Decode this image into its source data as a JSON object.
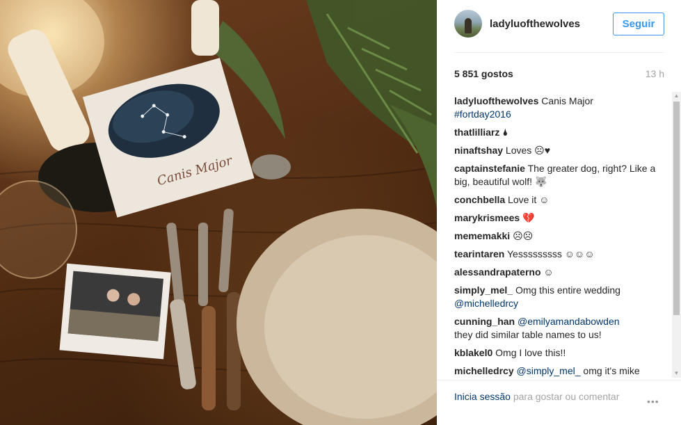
{
  "post": {
    "username": "ladyluofthewolves",
    "follow_label": "Seguir",
    "likes": "5 851 gostos",
    "time_ago": "13 h"
  },
  "comments": [
    {
      "user": "ladyluofthewolves",
      "text": "Canis Major",
      "link": "#fortday2016"
    },
    {
      "user": "thatlilliarz",
      "text": "🌢"
    },
    {
      "user": "ninaftshay",
      "text": "Loves ☹♥"
    },
    {
      "user": "captainstefanie",
      "text": "The greater dog, right? Like a big, beautiful wolf! 🐺"
    },
    {
      "user": "conchbella",
      "text": "Love it ☺"
    },
    {
      "user": "marykrismees",
      "text": "💔"
    },
    {
      "user": "mememakki",
      "text": "☹☹"
    },
    {
      "user": "tearintaren",
      "text": "Yesssssssss ☺☺☺"
    },
    {
      "user": "alessandrapaterno",
      "text": "☺"
    },
    {
      "user": "simply_mel_",
      "text": "Omg this entire wedding",
      "link": "@michelledrcy"
    },
    {
      "user": "cunning_han",
      "link": "@emilyamandabowden",
      "text": "they did similar table names to us!"
    },
    {
      "user": "kblakel0",
      "text": "Omg I love this!!"
    },
    {
      "user": "michelledrcy",
      "link": "@simply_mel_",
      "text": "omg it's mike"
    }
  ],
  "footer": {
    "login_link": "Inicia sessão",
    "login_text": "para gostar ou comentar",
    "more_label": "•••"
  },
  "photo": {
    "card_text": "Canis Major"
  },
  "colors": {
    "accent": "#3897f0",
    "link": "#003569",
    "muted": "#a3a3a3"
  }
}
